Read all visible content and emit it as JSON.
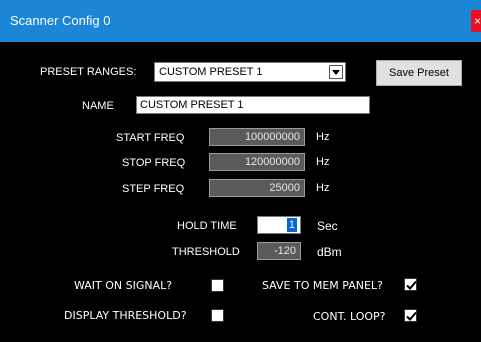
{
  "window": {
    "title": "Scanner Config 0",
    "close_glyph": "×"
  },
  "preset": {
    "label": "PRESET RANGES:",
    "selected": "CUSTOM PRESET 1",
    "save_button": "Save Preset"
  },
  "name": {
    "label": "NAME",
    "value": "CUSTOM PRESET 1"
  },
  "freqs": {
    "start": {
      "label": "START FREQ",
      "value": "100000000",
      "unit": "Hz"
    },
    "stop": {
      "label": "STOP FREQ",
      "value": "120000000",
      "unit": "Hz"
    },
    "step": {
      "label": "STEP FREQ",
      "value": "25000",
      "unit": "Hz"
    }
  },
  "hold": {
    "label": "HOLD TIME",
    "value": "1",
    "unit": "Sec"
  },
  "threshold": {
    "label": "THRESHOLD",
    "value": "-120",
    "unit": "dBm"
  },
  "checks": {
    "wait_on_signal": {
      "label": "WAIT ON SIGNAL?",
      "checked": false
    },
    "save_to_mem": {
      "label": "SAVE TO MEM PANEL?",
      "checked": true
    },
    "display_threshold": {
      "label": "DISPLAY THRESHOLD?",
      "checked": false
    },
    "cont_loop": {
      "label": "CONT. LOOP?",
      "checked": true
    }
  },
  "colors": {
    "title_bar": "#1b86d6",
    "background": "#000000",
    "close": "#e81123"
  }
}
